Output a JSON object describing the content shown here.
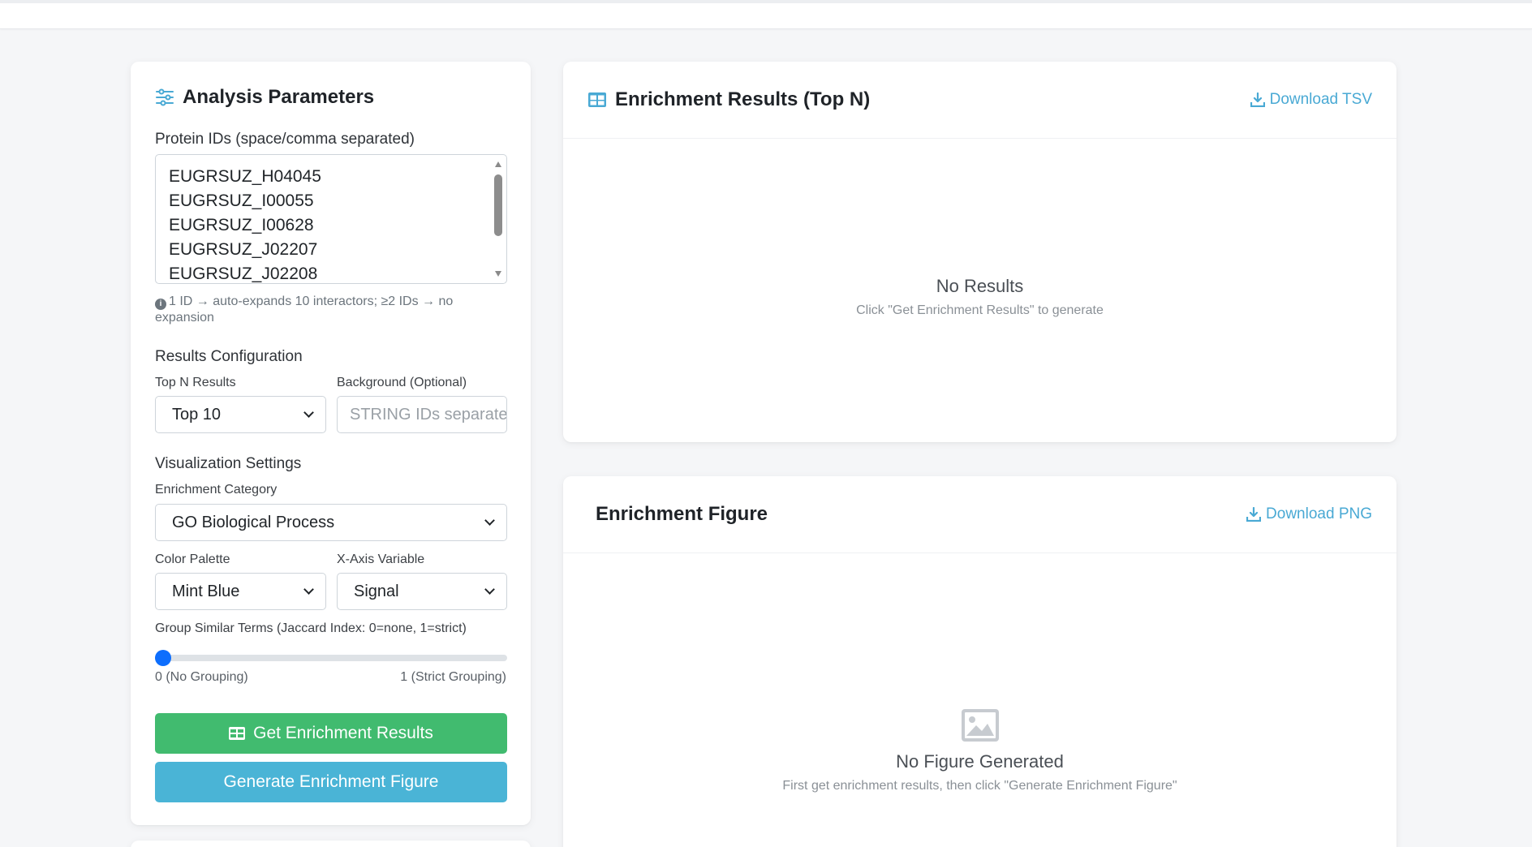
{
  "params": {
    "title": "Analysis Parameters",
    "protein_ids_label": "Protein IDs (space/comma separated)",
    "protein_ids": [
      "EUGRSUZ_H04045",
      "EUGRSUZ_I00055",
      "EUGRSUZ_I00628",
      "EUGRSUZ_J02207",
      "EUGRSUZ_J02208"
    ],
    "hint": "1 ID → auto-expands 10 interactors; ≥2 IDs → no expansion",
    "results_config_heading": "Results Configuration",
    "top_n_label": "Top N Results",
    "top_n_value": "Top 10",
    "background_label": "Background (Optional)",
    "background_placeholder": "STRING IDs separated",
    "viz_heading": "Visualization Settings",
    "category_label": "Enrichment Category",
    "category_value": "GO Biological Process",
    "palette_label": "Color Palette",
    "palette_value": "Mint Blue",
    "xaxis_label": "X-Axis Variable",
    "xaxis_value": "Signal",
    "grouping_label": "Group Similar Terms (Jaccard Index: 0=none, 1=strict)",
    "grouping_value": 0,
    "grouping_min_label": "0 (No Grouping)",
    "grouping_max_label": "1 (Strict Grouping)",
    "get_results_button": "Get Enrichment Results",
    "generate_figure_button": "Generate Enrichment Figure"
  },
  "results": {
    "title": "Enrichment Results (Top N)",
    "download_label": "Download TSV",
    "empty_title": "No Results",
    "empty_sub": "Click \"Get Enrichment Results\" to generate"
  },
  "figure": {
    "title": "Enrichment Figure",
    "download_label": "Download PNG",
    "empty_title": "No Figure Generated",
    "empty_sub": "First get enrichment results, then click \"Generate Enrichment Figure\""
  },
  "colors": {
    "accent": "#49a9d4",
    "success": "#41bb6f",
    "info": "#4ab4d6",
    "slider": "#0d6efd"
  },
  "icons": {
    "params": "sliders-icon",
    "results": "table-icon",
    "download": "download-icon",
    "figure_empty": "image-icon",
    "info": "info-icon"
  }
}
